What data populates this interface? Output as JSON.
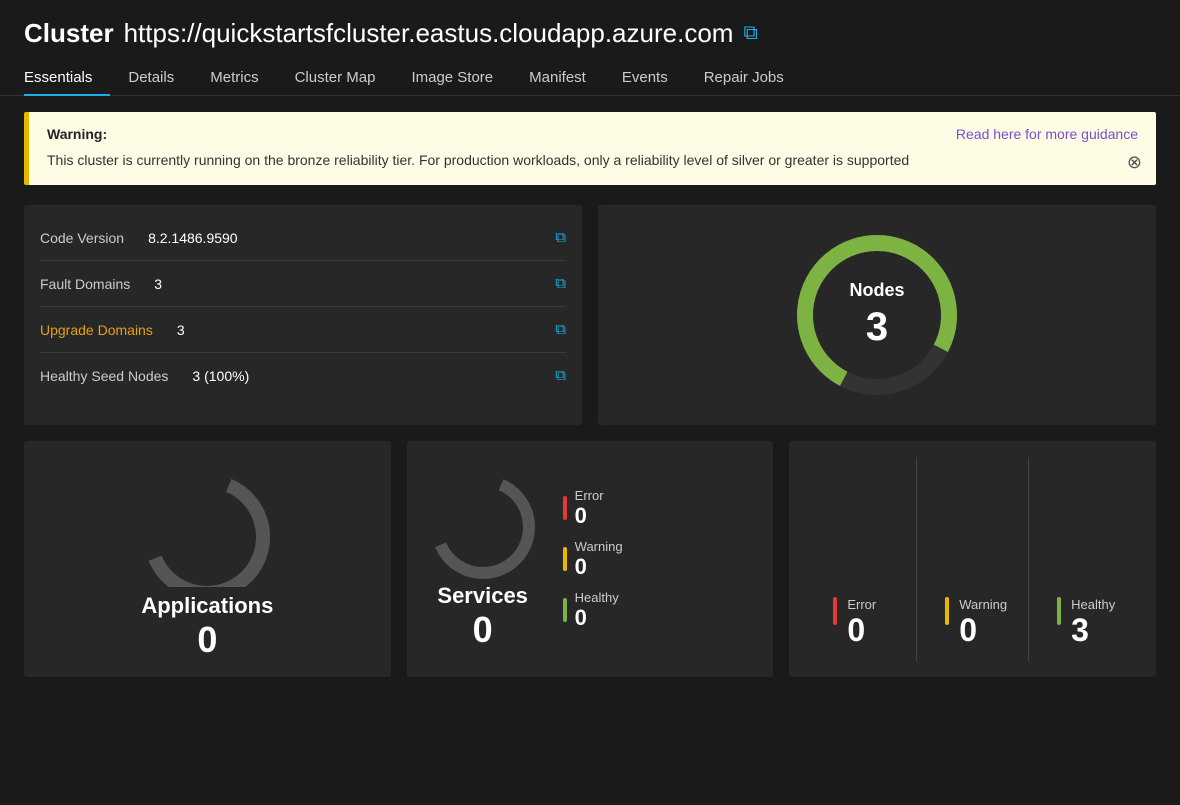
{
  "header": {
    "title_bold": "Cluster",
    "title_url": "https://quickstartsfcluster.eastus.cloudapp.azure.com",
    "copy_icon": "⧉"
  },
  "nav": {
    "tabs": [
      {
        "label": "Essentials",
        "active": true
      },
      {
        "label": "Details",
        "active": false
      },
      {
        "label": "Metrics",
        "active": false
      },
      {
        "label": "Cluster Map",
        "active": false
      },
      {
        "label": "Image Store",
        "active": false
      },
      {
        "label": "Manifest",
        "active": false
      },
      {
        "label": "Events",
        "active": false
      },
      {
        "label": "Repair Jobs",
        "active": false
      }
    ]
  },
  "warning": {
    "label": "Warning:",
    "link_text": "Read here for more guidance",
    "message": "This cluster is currently running on the bronze reliability tier. For production workloads, only a reliability level of silver or greater is supported",
    "close_icon": "⊗"
  },
  "info_rows": [
    {
      "label": "Code Version",
      "label_type": "normal",
      "value": "8.2.1486.9590"
    },
    {
      "label": "Fault Domains",
      "label_type": "normal",
      "value": "3"
    },
    {
      "label": "Upgrade Domains",
      "label_type": "warning",
      "value": "3"
    },
    {
      "label": "Healthy Seed Nodes",
      "label_type": "normal",
      "value": "3 (100%)"
    }
  ],
  "nodes_panel": {
    "title": "Nodes",
    "value": "3"
  },
  "applications": {
    "title": "Applications",
    "value": "0"
  },
  "services": {
    "title": "Services",
    "value": "0",
    "stats": [
      {
        "label": "Error",
        "value": "0",
        "type": "error"
      },
      {
        "label": "Warning",
        "value": "0",
        "type": "warning"
      },
      {
        "label": "Healthy",
        "value": "0",
        "type": "healthy"
      }
    ]
  },
  "nodes_stats": [
    {
      "label": "Error",
      "value": "0",
      "type": "error"
    },
    {
      "label": "Warning",
      "value": "0",
      "type": "warning"
    },
    {
      "label": "Healthy",
      "value": "3",
      "type": "healthy"
    }
  ]
}
